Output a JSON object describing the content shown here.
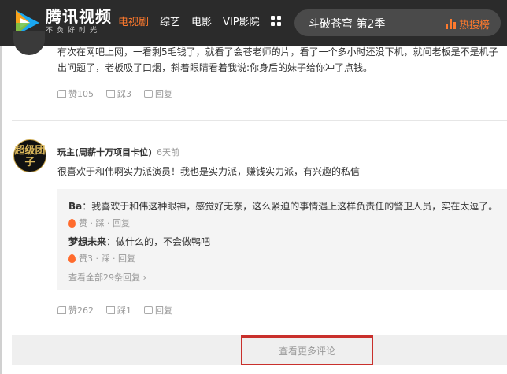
{
  "header": {
    "brand_name": "腾讯视频",
    "brand_slogan": "不负好时光",
    "nav": [
      {
        "label": "电视剧",
        "active": true
      },
      {
        "label": "综艺",
        "active": false
      },
      {
        "label": "电影",
        "active": false
      },
      {
        "label": "VIP影院",
        "active": false
      }
    ],
    "search_value": "斗破苍穹 第2季",
    "hot_label": "热搜榜"
  },
  "comments": [
    {
      "text": "有次在网吧上网，一看剩5毛钱了，就看了会苍老师的片，看了一个多小时还没下机，就问老板是不是机子出问题了，老板吸了口烟，斜着眼睛看着我说:你身后的妹子给你冲了点钱。",
      "like_label": "赞105",
      "dislike_label": "踩3",
      "reply_label": "回复"
    },
    {
      "avatar_text": "超级团子",
      "username": "玩主(周薪十万项目卡位)",
      "time": "6天前",
      "text": "很喜欢于和伟啊实力派演员！我也是实力派，赚钱实力派，有兴趣的私信",
      "replies": [
        {
          "author": "Ba",
          "text": "：我喜欢于和伟这种眼神，感觉好无奈，这么紧迫的事情遇上这样负责任的警卫人员，实在太逗了。",
          "actions": "赞 · 踩 · 回复"
        },
        {
          "author": "梦想未来",
          "text": "：做什么的，不会做鸭吧",
          "actions": "赞3 · 踩 · 回复"
        }
      ],
      "view_all_label": "查看全部29条回复",
      "like_label": "赞262",
      "dislike_label": "踩1",
      "reply_label": "回复"
    }
  ],
  "more_label": "查看更多评论",
  "colors": {
    "accent": "#ff7a2d",
    "header_bg": "#2b2b2b",
    "highlight_border": "#c9302c"
  }
}
